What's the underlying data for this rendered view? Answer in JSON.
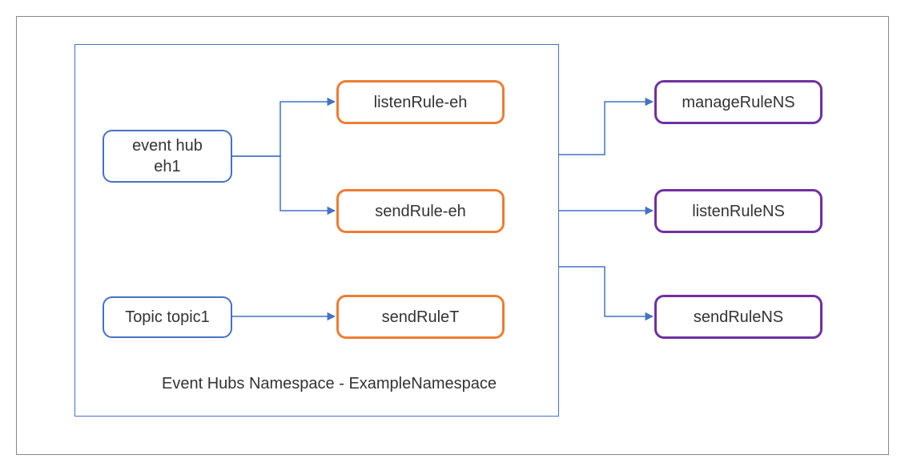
{
  "namespace": {
    "caption": "Event Hubs Namespace - ExampleNamespace"
  },
  "entities": {
    "eh1_line1": "event hub",
    "eh1_line2": "eh1",
    "topic1": "Topic topic1"
  },
  "rules": {
    "listenRuleEh": "listenRule-eh",
    "sendRuleEh": "sendRule-eh",
    "sendRuleT": "sendRuleT",
    "manageRuleNS": "manageRuleNS",
    "listenRuleNS": "listenRuleNS",
    "sendRuleNS": "sendRuleNS"
  },
  "colors": {
    "entity": "#4472C4",
    "entityRule": "#ED7D31",
    "namespaceRule": "#7030A0",
    "connector": "#4472C4"
  }
}
